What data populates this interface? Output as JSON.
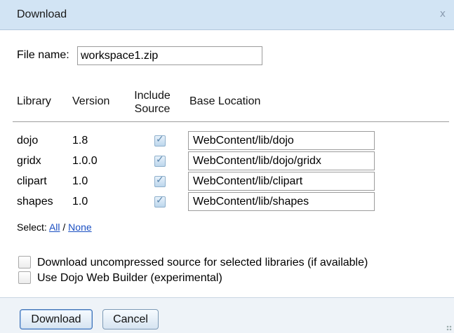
{
  "dialog": {
    "title": "Download",
    "close_glyph": "x"
  },
  "file_name": {
    "label": "File name:",
    "value": "workspace1.zip"
  },
  "columns": {
    "library": "Library",
    "version": "Version",
    "include_line1": "Include",
    "include_line2": "Source",
    "base_location": "Base Location"
  },
  "libraries": [
    {
      "name": "dojo",
      "version": "1.8",
      "include_source": true,
      "location": "WebContent/lib/dojo"
    },
    {
      "name": "gridx",
      "version": "1.0.0",
      "include_source": true,
      "location": "WebContent/lib/dojo/gridx"
    },
    {
      "name": "clipart",
      "version": "1.0",
      "include_source": true,
      "location": "WebContent/lib/clipart"
    },
    {
      "name": "shapes",
      "version": "1.0",
      "include_source": true,
      "location": "WebContent/lib/shapes"
    }
  ],
  "select": {
    "label": "Select:",
    "all": "All",
    "separator": "/",
    "none": "None"
  },
  "options": {
    "uncompressed": {
      "label": "Download uncompressed source for selected libraries (if available)",
      "checked": false
    },
    "web_builder": {
      "label": "Use Dojo Web Builder (experimental)",
      "checked": false
    }
  },
  "buttons": {
    "download": "Download",
    "cancel": "Cancel"
  },
  "icons": {
    "checkmark": "checkmark-icon",
    "close": "close-icon"
  }
}
